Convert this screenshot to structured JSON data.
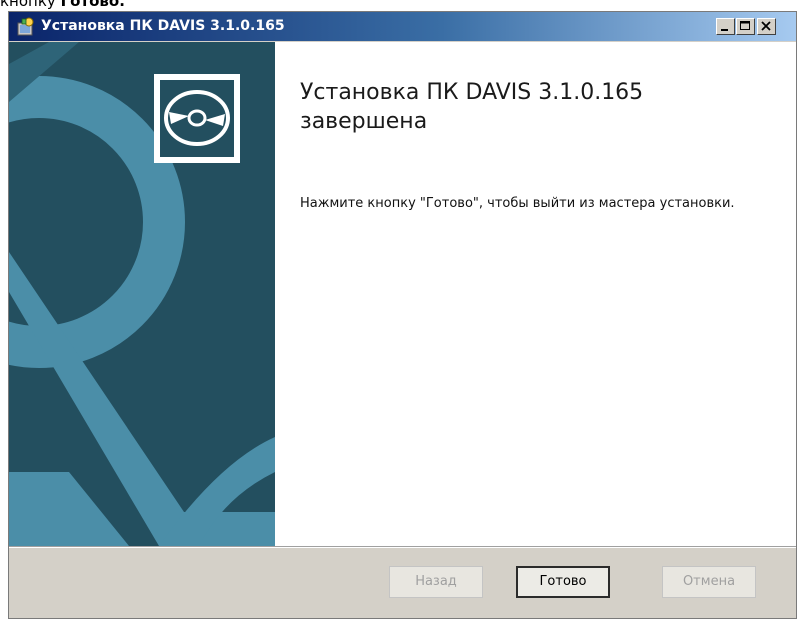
{
  "document": {
    "prefix": "кнопку ",
    "bold": "Готово."
  },
  "window": {
    "title": "Установка ПК DAVIS 3.1.0.165",
    "icons": {
      "app": "installer-icon",
      "minimize": "minimize-icon",
      "maximize": "maximize-icon",
      "close": "close-icon"
    }
  },
  "banner": {
    "icon": "cd-disc-icon",
    "colors": {
      "dark": "#234f5f",
      "light": "#4b8ea8"
    }
  },
  "main": {
    "heading": "Установка ПК DAVIS 3.1.0.165 завершена",
    "description": "Нажмите кнопку \"Готово\", чтобы выйти из мастера установки."
  },
  "footer": {
    "back_label": "Назад",
    "finish_label": "Готово",
    "cancel_label": "Отмена"
  }
}
